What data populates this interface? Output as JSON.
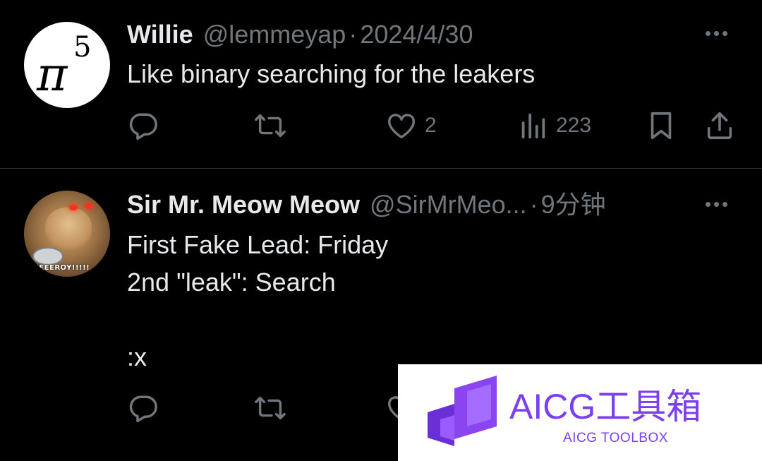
{
  "tweets": [
    {
      "name": "Willie",
      "handle": "@lemmeyap",
      "separator": "·",
      "time": "2024/4/30",
      "text": "Like binary searching for the leakers",
      "avatar": {
        "base": "π",
        "exponent": "5"
      },
      "likes": "2",
      "views": "223"
    },
    {
      "name": "Sir Mr. Meow Meow",
      "handle": "@SirMrMeo...",
      "separator": "·",
      "time": "9分钟",
      "text": "First Fake Lead: Friday\n2nd \"leak\": Search\n\n:x",
      "avatar": {
        "caption": "FEEEROY!!!!!"
      }
    }
  ],
  "icons": {
    "reply": "reply-icon",
    "retweet": "retweet-icon",
    "like": "heart-icon",
    "views": "views-icon",
    "bookmark": "bookmark-icon",
    "share": "share-icon",
    "more": "more-icon"
  },
  "watermark": {
    "title": "AICG工具箱",
    "subtitle": "AICG TOOLBOX"
  },
  "colors": {
    "background": "#000000",
    "text": "#e7e9ea",
    "muted": "#71767b",
    "divider": "#2f3336",
    "watermark_purple": "#7b3ff2"
  }
}
